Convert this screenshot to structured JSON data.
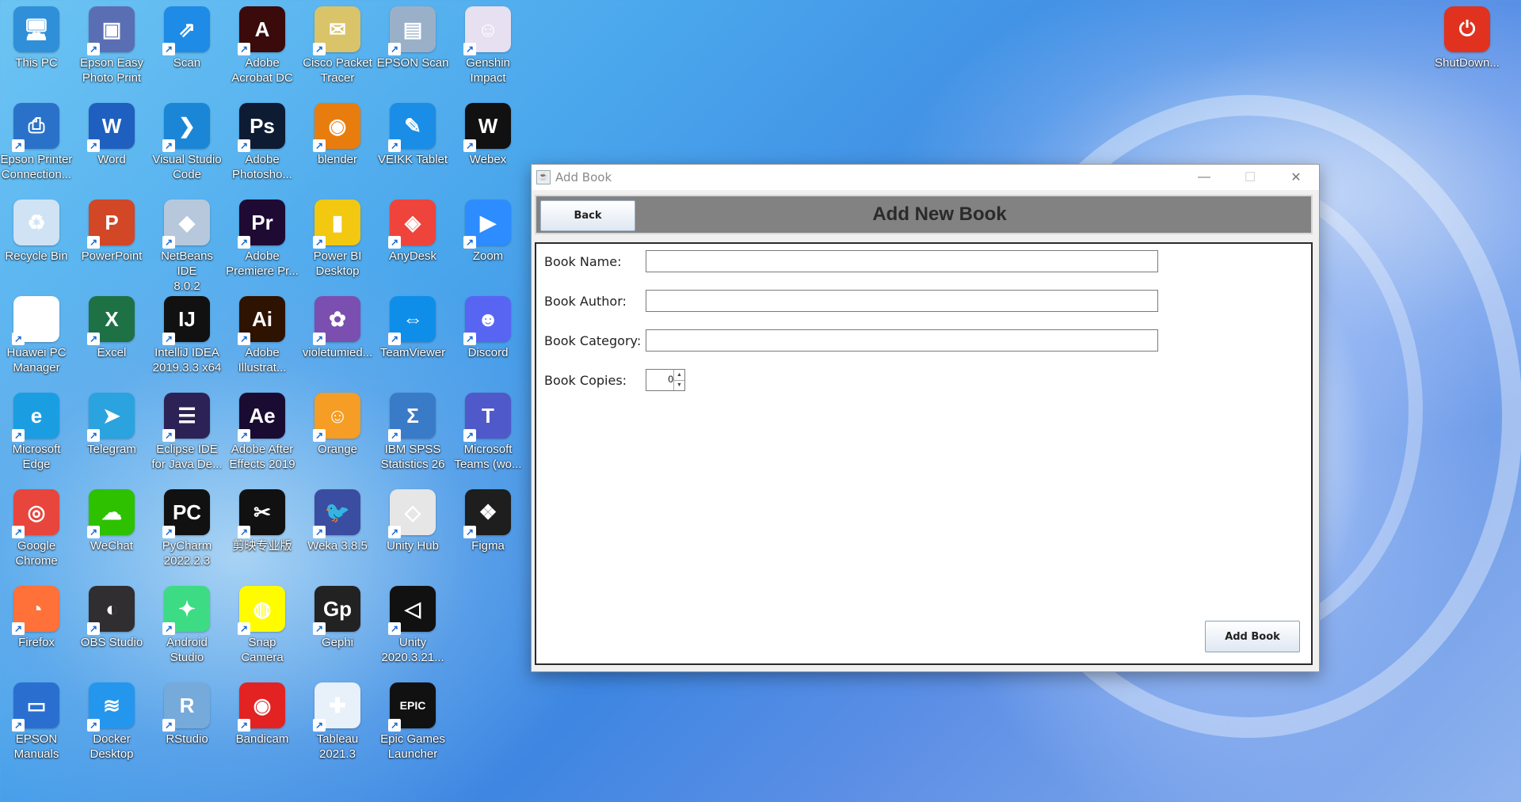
{
  "desktop": {
    "icons": [
      {
        "label": "This PC",
        "icon": "computer-icon",
        "color": "#2f8fd8"
      },
      {
        "label": "Epson Easy\nPhoto Print",
        "icon": "photo-print-icon",
        "color": "#5a6fb3"
      },
      {
        "label": "Scan",
        "icon": "scan-icon",
        "color": "#1e8be6"
      },
      {
        "label": "Adobe\nAcrobat DC",
        "icon": "acrobat-icon",
        "color": "#3b0a0a"
      },
      {
        "label": "Cisco Packet\nTracer",
        "icon": "packet-tracer-icon",
        "color": "#d9c46a"
      },
      {
        "label": "EPSON Scan",
        "icon": "epson-scan-icon",
        "color": "#9ab0c8"
      },
      {
        "label": "Genshin\nImpact",
        "icon": "genshin-icon",
        "color": "#e7e0f0"
      },
      {
        "label": "Epson Printer\nConnection...",
        "icon": "epson-printer-icon",
        "color": "#2a72c9"
      },
      {
        "label": "Word",
        "icon": "word-icon",
        "color": "#1f5fbf"
      },
      {
        "label": "Visual Studio\nCode",
        "icon": "vscode-icon",
        "color": "#1b86d6"
      },
      {
        "label": "Adobe\nPhotosho...",
        "icon": "photoshop-icon",
        "color": "#0d1b33"
      },
      {
        "label": "blender",
        "icon": "blender-icon",
        "color": "#e87d0d"
      },
      {
        "label": "VEIKK Tablet",
        "icon": "veikk-icon",
        "color": "#1a8de6"
      },
      {
        "label": "Webex",
        "icon": "webex-icon",
        "color": "#111111"
      },
      {
        "label": "Recycle Bin",
        "icon": "recycle-bin-icon",
        "color": "#cfe3f5"
      },
      {
        "label": "PowerPoint",
        "icon": "powerpoint-icon",
        "color": "#d24726"
      },
      {
        "label": "NetBeans IDE\n8.0.2",
        "icon": "netbeans-icon",
        "color": "#b8c8dc"
      },
      {
        "label": "Adobe\nPremiere Pr...",
        "icon": "premiere-icon",
        "color": "#1f0a33"
      },
      {
        "label": "Power BI\nDesktop",
        "icon": "powerbi-icon",
        "color": "#f2c811"
      },
      {
        "label": "AnyDesk",
        "icon": "anydesk-icon",
        "color": "#ef443b"
      },
      {
        "label": "Zoom",
        "icon": "zoom-icon",
        "color": "#2d8cff"
      },
      {
        "label": "Huawei PC\nManager",
        "icon": "huawei-icon",
        "color": "#ffffff"
      },
      {
        "label": "Excel",
        "icon": "excel-icon",
        "color": "#1e7145"
      },
      {
        "label": "IntelliJ IDEA\n2019.3.3 x64",
        "icon": "intellij-icon",
        "color": "#111111"
      },
      {
        "label": "Adobe\nIllustrat...",
        "icon": "illustrator-icon",
        "color": "#2e1300"
      },
      {
        "label": "violetumied...",
        "icon": "violet-flower-icon",
        "color": "#7a4fb0"
      },
      {
        "label": "TeamViewer",
        "icon": "teamviewer-icon",
        "color": "#0e8ee9"
      },
      {
        "label": "Discord",
        "icon": "discord-icon",
        "color": "#5865f2"
      },
      {
        "label": "Microsoft\nEdge",
        "icon": "edge-icon",
        "color": "#1b9de2"
      },
      {
        "label": "Telegram",
        "icon": "telegram-icon",
        "color": "#2aa3de"
      },
      {
        "label": "Eclipse IDE\nfor Java De...",
        "icon": "eclipse-icon",
        "color": "#2c2255"
      },
      {
        "label": "Adobe After\nEffects 2019",
        "icon": "after-effects-icon",
        "color": "#1a0b33"
      },
      {
        "label": "Orange",
        "icon": "orange-icon",
        "color": "#f59d24"
      },
      {
        "label": "IBM SPSS\nStatistics 26",
        "icon": "spss-icon",
        "color": "#3a7bc8"
      },
      {
        "label": "Microsoft\nTeams (wo...",
        "icon": "teams-icon",
        "color": "#5059c9"
      },
      {
        "label": "Google\nChrome",
        "icon": "chrome-icon",
        "color": "#e8453c"
      },
      {
        "label": "WeChat",
        "icon": "wechat-icon",
        "color": "#2dc100"
      },
      {
        "label": "PyCharm\n2022.2.3",
        "icon": "pycharm-icon",
        "color": "#111111"
      },
      {
        "label": "剪映专业版",
        "icon": "capcut-icon",
        "color": "#111111"
      },
      {
        "label": "Weka 3.8.5",
        "icon": "weka-icon",
        "color": "#3b4da0"
      },
      {
        "label": "Unity Hub",
        "icon": "unity-hub-icon",
        "color": "#e6e6e6"
      },
      {
        "label": "Figma",
        "icon": "figma-icon",
        "color": "#1e1e1e"
      },
      {
        "label": "Firefox",
        "icon": "firefox-icon",
        "color": "#ff7139"
      },
      {
        "label": "OBS Studio",
        "icon": "obs-icon",
        "color": "#302e31"
      },
      {
        "label": "Android\nStudio",
        "icon": "android-studio-icon",
        "color": "#3ddc84"
      },
      {
        "label": "Snap Camera",
        "icon": "snap-camera-icon",
        "color": "#fffc00"
      },
      {
        "label": "Gephi",
        "icon": "gephi-icon",
        "color": "#222222"
      },
      {
        "label": "Unity\n2020.3.21...",
        "icon": "unity-icon",
        "color": "#111111"
      },
      {
        "label": "",
        "icon": "blank",
        "color": "rgba(0,0,0,0)"
      },
      {
        "label": "EPSON\nManuals",
        "icon": "epson-manuals-icon",
        "color": "#2a6fd0"
      },
      {
        "label": "Docker\nDesktop",
        "icon": "docker-icon",
        "color": "#2496ed"
      },
      {
        "label": "RStudio",
        "icon": "rstudio-icon",
        "color": "#75aadb"
      },
      {
        "label": "Bandicam",
        "icon": "bandicam-icon",
        "color": "#e32222"
      },
      {
        "label": "Tableau\n2021.3",
        "icon": "tableau-icon",
        "color": "#e8f0fa"
      },
      {
        "label": "Epic Games\nLauncher",
        "icon": "epic-games-icon",
        "color": "#111111"
      }
    ],
    "shutdown": {
      "label": "ShutDown...",
      "icon": "shutdown-icon",
      "color": "#e0321e"
    }
  },
  "window": {
    "title": "Add Book",
    "controls": {
      "minimize": "—",
      "maximize": "☐",
      "close": "✕"
    },
    "back_label": "Back",
    "heading": "Add New Book",
    "fields": [
      {
        "label": "Book Name:",
        "value": ""
      },
      {
        "label": "Book Author:",
        "value": ""
      },
      {
        "label": "Book Category:",
        "value": ""
      }
    ],
    "copies": {
      "label": "Book Copies:",
      "value": "0"
    },
    "add_label": "Add Book"
  }
}
